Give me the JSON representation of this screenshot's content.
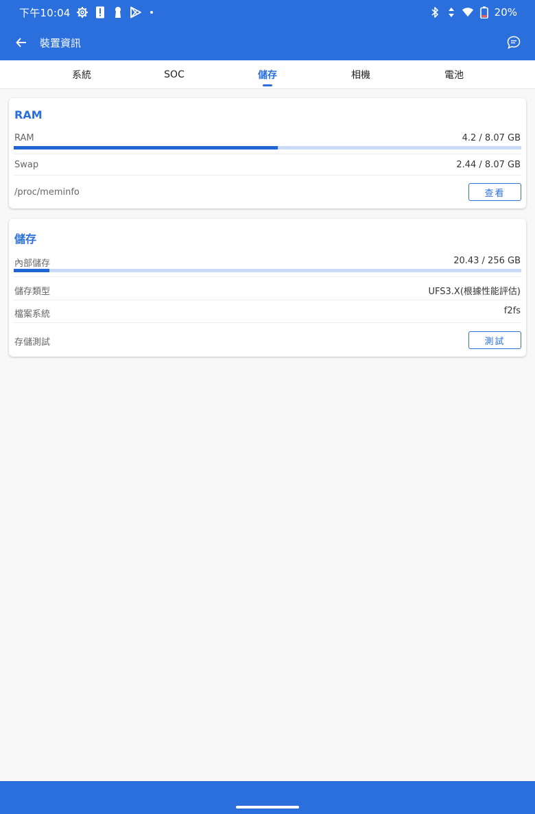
{
  "status_bar": {
    "time": "下午10:04",
    "battery": "20%",
    "icons": [
      "gear-icon",
      "alert-icon",
      "keyhole-icon",
      "play-store-icon",
      "bluetooth-icon",
      "data-arrows-icon",
      "wifi-icon",
      "battery-icon"
    ]
  },
  "app_bar": {
    "title": "裝置資訊",
    "back_icon": "back-arrow-icon",
    "chat_icon": "chat-bubble-icon"
  },
  "tabs": [
    {
      "label": "系統",
      "active": false
    },
    {
      "label": "SOC",
      "active": false
    },
    {
      "label": "儲存",
      "active": true
    },
    {
      "label": "相機",
      "active": false
    },
    {
      "label": "電池",
      "active": false
    }
  ],
  "ram_card": {
    "title": "RAM",
    "ram_label": "RAM",
    "ram_value": "4.2 / 8.07 GB",
    "ram_fraction": 0.52,
    "swap_label": "Swap",
    "swap_value": "2.44 / 8.07 GB",
    "meminfo_label": "/proc/meminfo",
    "view_button": "查看"
  },
  "storage_card": {
    "title": "儲存",
    "internal_label": "內部儲存",
    "internal_value": "20.43 / 256 GB",
    "internal_fraction": 0.07,
    "type_label": "儲存類型",
    "type_value": "UFS3.X(根據性能評估)",
    "fs_label": "檔案系統",
    "fs_value": "f2fs",
    "test_label": "存儲測試",
    "test_button": "測試"
  },
  "colors": {
    "primary": "#2a6fdc",
    "bar_fill": "#1f66d4",
    "bar_track": "#c9dbf6"
  }
}
